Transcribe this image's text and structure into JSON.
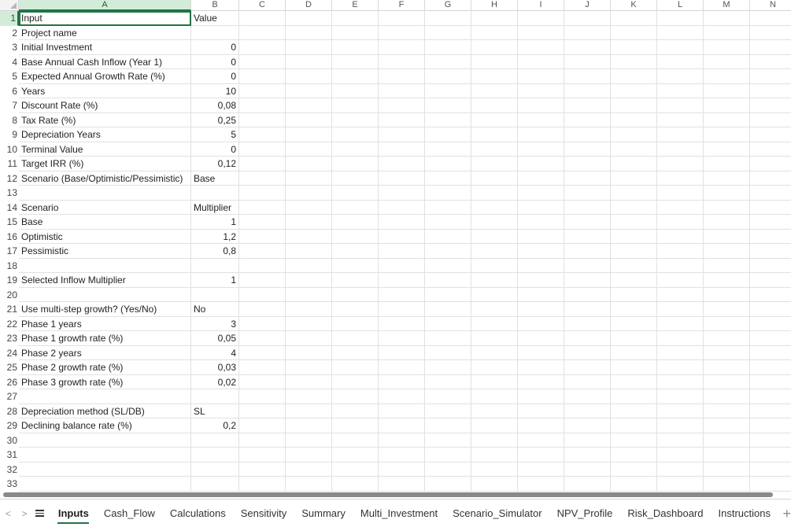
{
  "columns": [
    "A",
    "B",
    "C",
    "D",
    "E",
    "F",
    "G",
    "H",
    "I",
    "J",
    "K",
    "L",
    "M",
    "N"
  ],
  "rows": [
    {
      "n": "1",
      "a": "Input",
      "b": "Value",
      "b_type": "text"
    },
    {
      "n": "2",
      "a": "Project name",
      "b": "",
      "b_type": "text"
    },
    {
      "n": "3",
      "a": "Initial Investment",
      "b": "0",
      "b_type": "num"
    },
    {
      "n": "4",
      "a": "Base Annual Cash Inflow (Year 1)",
      "b": "0",
      "b_type": "num"
    },
    {
      "n": "5",
      "a": "Expected Annual Growth Rate (%)",
      "b": "0",
      "b_type": "num"
    },
    {
      "n": "6",
      "a": "Years",
      "b": "10",
      "b_type": "num"
    },
    {
      "n": "7",
      "a": "Discount Rate (%)",
      "b": "0,08",
      "b_type": "num"
    },
    {
      "n": "8",
      "a": "Tax Rate (%)",
      "b": "0,25",
      "b_type": "num"
    },
    {
      "n": "9",
      "a": "Depreciation Years",
      "b": "5",
      "b_type": "num"
    },
    {
      "n": "10",
      "a": "Terminal Value",
      "b": "0",
      "b_type": "num"
    },
    {
      "n": "11",
      "a": "Target IRR (%)",
      "b": "0,12",
      "b_type": "num"
    },
    {
      "n": "12",
      "a": "Scenario (Base/Optimistic/Pessimistic)",
      "b": "Base",
      "b_type": "text"
    },
    {
      "n": "13",
      "a": "",
      "b": "",
      "b_type": "text"
    },
    {
      "n": "14",
      "a": "Scenario",
      "b": "Multiplier",
      "b_type": "text"
    },
    {
      "n": "15",
      "a": "Base",
      "b": "1",
      "b_type": "num"
    },
    {
      "n": "16",
      "a": "Optimistic",
      "b": "1,2",
      "b_type": "num"
    },
    {
      "n": "17",
      "a": "Pessimistic",
      "b": "0,8",
      "b_type": "num"
    },
    {
      "n": "18",
      "a": "",
      "b": "",
      "b_type": "text"
    },
    {
      "n": "19",
      "a": "Selected Inflow Multiplier",
      "b": "1",
      "b_type": "num"
    },
    {
      "n": "20",
      "a": "",
      "b": "",
      "b_type": "text"
    },
    {
      "n": "21",
      "a": "Use multi-step growth? (Yes/No)",
      "b": "No",
      "b_type": "text"
    },
    {
      "n": "22",
      "a": "Phase 1 years",
      "b": "3",
      "b_type": "num"
    },
    {
      "n": "23",
      "a": "Phase 1 growth rate (%)",
      "b": "0,05",
      "b_type": "num"
    },
    {
      "n": "24",
      "a": "Phase 2 years",
      "b": "4",
      "b_type": "num"
    },
    {
      "n": "25",
      "a": "Phase 2 growth rate (%)",
      "b": "0,03",
      "b_type": "num"
    },
    {
      "n": "26",
      "a": "Phase 3 growth rate (%)",
      "b": "0,02",
      "b_type": "num"
    },
    {
      "n": "27",
      "a": "",
      "b": "",
      "b_type": "text"
    },
    {
      "n": "28",
      "a": "Depreciation method (SL/DB)",
      "b": "SL",
      "b_type": "text"
    },
    {
      "n": "29",
      "a": "Declining balance rate (%)",
      "b": "0,2",
      "b_type": "num"
    },
    {
      "n": "30",
      "a": "",
      "b": "",
      "b_type": "text"
    },
    {
      "n": "31",
      "a": "",
      "b": "",
      "b_type": "text"
    },
    {
      "n": "32",
      "a": "",
      "b": "",
      "b_type": "text"
    },
    {
      "n": "33",
      "a": "",
      "b": "",
      "b_type": "text"
    }
  ],
  "active_cell": {
    "col": "A",
    "row": "1"
  },
  "tabbar": {
    "prev_arrow": "<",
    "next_arrow": ">",
    "add_label": "+",
    "tabs": [
      {
        "label": "Inputs",
        "active": true
      },
      {
        "label": "Cash_Flow",
        "active": false
      },
      {
        "label": "Calculations",
        "active": false
      },
      {
        "label": "Sensitivity",
        "active": false
      },
      {
        "label": "Summary",
        "active": false
      },
      {
        "label": "Multi_Investment",
        "active": false
      },
      {
        "label": "Scenario_Simulator",
        "active": false
      },
      {
        "label": "NPV_Profile",
        "active": false
      },
      {
        "label": "Risk_Dashboard",
        "active": false
      },
      {
        "label": "Instructions",
        "active": false
      }
    ]
  },
  "colors": {
    "accent": "#217346",
    "selected_header_bg": "#d3ecd9",
    "gridline": "#e1e1e1"
  }
}
